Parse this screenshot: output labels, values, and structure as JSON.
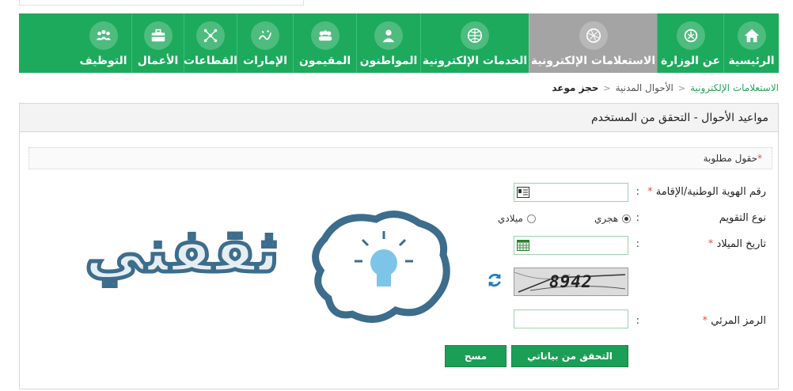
{
  "nav": {
    "items": [
      {
        "label": "الرئيسية",
        "icon": "home-icon",
        "active": false
      },
      {
        "label": "عن الوزارة",
        "icon": "emblem-icon",
        "active": false
      },
      {
        "label": "الاستعلامات الإلكترونية",
        "icon": "globe-icon",
        "active": true
      },
      {
        "label": "الخدمات الإلكترونية",
        "icon": "globe-grid-icon",
        "active": false
      },
      {
        "label": "المواطنون",
        "icon": "citizen-icon",
        "active": false
      },
      {
        "label": "المقيمون",
        "icon": "residents-icon",
        "active": false
      },
      {
        "label": "الإمارات",
        "icon": "calligraphy-icon",
        "active": false
      },
      {
        "label": "القطاعات",
        "icon": "network-icon",
        "active": false
      },
      {
        "label": "الأعمال",
        "icon": "briefcase-icon",
        "active": false
      },
      {
        "label": "التوظيف",
        "icon": "team-icon",
        "active": false
      }
    ]
  },
  "breadcrumb": {
    "root": "الاستعلامات الإلكترونية",
    "mid": "الأحوال المدنية",
    "current": "حجز موعد",
    "sep": "<"
  },
  "panel": {
    "title": "مواعيد الأحوال - التحقق من المستخدم"
  },
  "form": {
    "required_star": "*",
    "required_note": "حقول مطلوبة",
    "colon": ":",
    "id_label": "رقم الهوية الوطنية/الإقامة",
    "calendar_label": "نوع التقويم",
    "calendar_options": [
      "هجري",
      "ميلادي"
    ],
    "calendar_selected": "هجري",
    "birth_label": "تاريخ الميلاد",
    "captcha_text": "8942",
    "captcha_label": "الرمز المرئي",
    "verify_button": "التحقق من بياناتي",
    "clear_button": "مسح"
  },
  "watermark": {
    "text": "ثقفني"
  },
  "colors": {
    "brand_green": "#1daa5c",
    "active_tab": "#a4a4a4",
    "button_green": "#1b9e55",
    "required_red": "#d9534f"
  }
}
